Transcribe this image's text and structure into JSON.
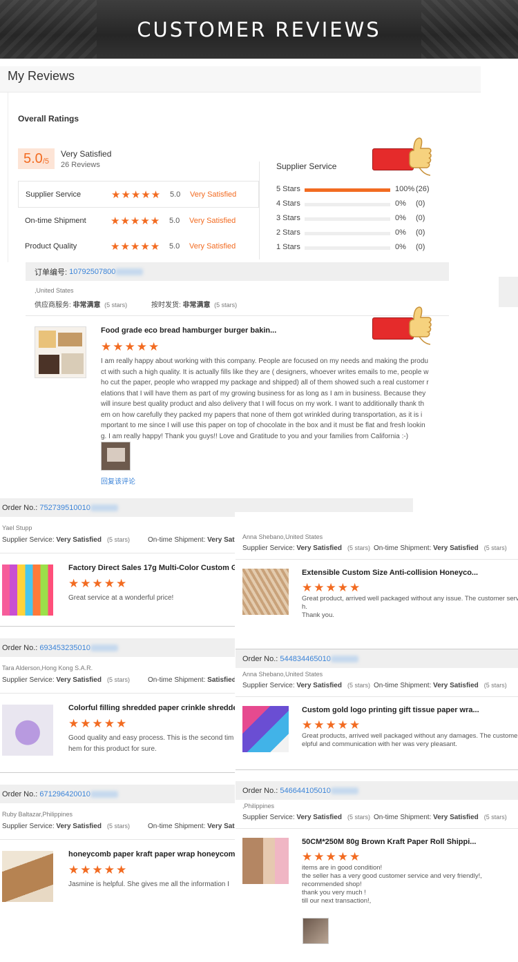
{
  "banner": {
    "title": "CUSTOMER REVIEWS"
  },
  "my_reviews": {
    "title": "My Reviews",
    "overall_label": "Overall Ratings",
    "score": "5.0",
    "score_suffix": "/5",
    "rating_word": "Very Satisfied",
    "review_count": "26 Reviews"
  },
  "ratings": [
    {
      "label": "Supplier Service",
      "stars": 5,
      "score": "5.0",
      "word": "Very Satisfied"
    },
    {
      "label": "On-time Shipment",
      "stars": 5,
      "score": "5.0",
      "word": "Very Satisfied"
    },
    {
      "label": "Product Quality",
      "stars": 5,
      "score": "5.0",
      "word": "Very Satisfied"
    }
  ],
  "distribution": {
    "title": "Supplier Service",
    "rows": [
      {
        "label": "5 Stars",
        "fraction": 1.0,
        "pct": "100%",
        "count": "(26)"
      },
      {
        "label": "4 Stars",
        "fraction": 0,
        "pct": "0%",
        "count": "(0)"
      },
      {
        "label": "3 Stars",
        "fraction": 0,
        "pct": "0%",
        "count": "(0)"
      },
      {
        "label": "2 Stars",
        "fraction": 0,
        "pct": "0%",
        "count": "(0)"
      },
      {
        "label": "1 Stars",
        "fraction": 0,
        "pct": "0%",
        "count": "(0)"
      }
    ]
  },
  "first_review": {
    "order_label": "订单编号:",
    "order_no": "10792507800",
    "location": ",United States",
    "supplier_label": "供应商服务:",
    "supplier_value": "非常满意",
    "supplier_stars": "(5 stars)",
    "ship_label": "按时发货:",
    "ship_value": "非常满意",
    "ship_stars": "(5 stars)",
    "product": "Food grade eco bread hamburger burger bakin...",
    "text_lines": [
      "I am really happy about working with this company. People are focused on my needs and making the produ",
      "ct with such a high quality. It is actually fills like they are ( designers, whoever writes emails to me, people w",
      "ho cut the paper, people who wrapped my package and shipped) all of them showed such a real customer r",
      "elations that I will have them as part of my growing business for as long as I am in business. Because they",
      "will insure best quality product and also delivery that I will focus on my work.  I want to additionally thank th",
      "em on how carefully they packed my papers that none of them got wrinkled during transportation, as it is i",
      "mportant to me since I will use this paper on top of chocolate in the box and it must be flat and fresh lookin",
      "g. I am really happy! Thank you guys!! Love and Gratitude to you and your families from California :-)"
    ],
    "reply": "回复该评论"
  },
  "left_reviews": [
    {
      "order_label": "Order No.:",
      "order_no": "752739510010",
      "location": "Yael Stupp",
      "supplier_label": "Supplier Service:",
      "supplier_value": "Very Satisfied",
      "supplier_stars": "(5 stars)",
      "ship_label": "On-time Shipment:",
      "ship_value": "Very Sat",
      "product": "Factory Direct Sales 17g Multi-Color Custom G",
      "text_lines": [
        "Great service at a wonderful price!"
      ]
    },
    {
      "order_label": "Order No.:",
      "order_no": "693453235010",
      "location": "Tara Alderson,Hong Kong S.A.R.",
      "supplier_label": "Supplier Service:",
      "supplier_value": "Very Satisfied",
      "supplier_stars": "(5 stars)",
      "ship_label": "On-time Shipment:",
      "ship_value": "Satisfied",
      "product": "Colorful filling shredded paper crinkle shredde",
      "text_lines": [
        "Good quality and easy process. This is the second tim",
        "hem for this product for sure."
      ]
    },
    {
      "order_label": "Order No.:",
      "order_no": "671296420010",
      "location": "Ruby Baltazar,Philippines",
      "supplier_label": "Supplier Service:",
      "supplier_value": "Very Satisfied",
      "supplier_stars": "(5 stars)",
      "ship_label": "On-time Shipment:",
      "ship_value": "Very Sat",
      "product": "honeycomb paper kraft paper wrap honeycom",
      "text_lines": [
        "Jasmine is helpful. She gives me all the information I"
      ]
    }
  ],
  "right_reviews": [
    {
      "order_label": "",
      "order_no": "",
      "location": "Anna Shebano,United States",
      "supplier_label": "Supplier Service:",
      "supplier_value": "Very Satisfied",
      "supplier_stars": "(5 stars)",
      "ship_label": "On-time Shipment:",
      "ship_value": "Very Satisfied",
      "ship_stars": "(5 stars)",
      "product": "Extensible Custom Size Anti-collision Honeyco...",
      "text_lines": [
        "Great product, arrived well packaged without any issue. The customer servic",
        "h.",
        "Thank you."
      ]
    },
    {
      "order_label": "Order No.:",
      "order_no": "544834465010",
      "location": "Anna Shebano,United States",
      "supplier_label": "Supplier Service:",
      "supplier_value": "Very Satisfied",
      "supplier_stars": "(5 stars)",
      "ship_label": "On-time Shipment:",
      "ship_value": "Very Satisfied",
      "ship_stars": "(5 stars)",
      "product": "Custom gold logo printing gift tissue paper wra...",
      "text_lines": [
        "Great products, arrived well packaged without any damages. The customer s",
        "elpful and communication with her was very pleasant."
      ]
    },
    {
      "order_label": "Order No.:",
      "order_no": "546644105010",
      "location": ",Philippines",
      "supplier_label": "Supplier Service:",
      "supplier_value": "Very Satisfied",
      "supplier_stars": "(5 stars)",
      "ship_label": "On-time Shipment:",
      "ship_value": "Very Satisfied",
      "ship_stars": "(5 stars)",
      "product": "50CM*250M 80g Brown Kraft Paper Roll Shippi...",
      "text_lines": [
        "items are in good condition!",
        "the seller has a very good customer service and very friendly!,",
        "recommended shop!",
        "thank you very much !",
        "till our next transaction!,"
      ]
    }
  ],
  "colors": {
    "accent": "#f26b21",
    "link": "#3a83d8",
    "badge_bg": "#fde4d6"
  }
}
